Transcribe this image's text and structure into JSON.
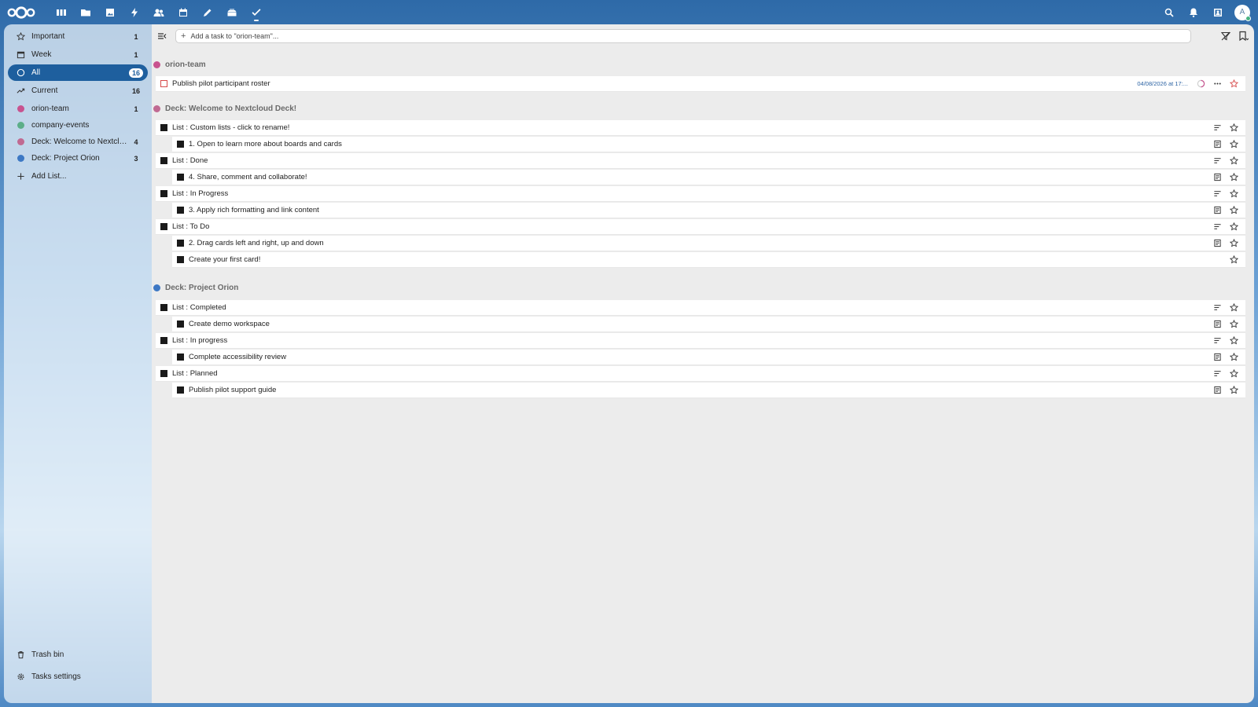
{
  "header": {
    "apps": [
      "dashboard",
      "files",
      "photos",
      "activity",
      "contacts",
      "calendar",
      "notes",
      "deck",
      "tasks"
    ],
    "right_icons": [
      "search",
      "notifications",
      "contacts-menu"
    ],
    "avatar_initial": "A"
  },
  "sidebar": {
    "items": [
      {
        "label": "Important",
        "count": "1",
        "icon": "star-icon"
      },
      {
        "label": "Week",
        "count": "1",
        "icon": "calendar-icon"
      },
      {
        "label": "All",
        "count": "16",
        "icon": "circle-icon"
      },
      {
        "label": "Current",
        "count": "16",
        "icon": "trend-icon"
      },
      {
        "label": "orion-team",
        "count": "1",
        "color": "#c8538f"
      },
      {
        "label": "company-events",
        "count": "",
        "color": "#5cae88"
      },
      {
        "label": "Deck: Welcome to Nextclou...",
        "count": "4",
        "color": "#c06a92"
      },
      {
        "label": "Deck: Project Orion",
        "count": "3",
        "color": "#3d78c4"
      }
    ],
    "add_list": "Add List...",
    "trash": "Trash bin",
    "settings": "Tasks settings"
  },
  "main": {
    "add_placeholder": "Add a task to \"orion-team\"...",
    "sections": [
      {
        "title": "orion-team",
        "color": "#c8538f",
        "tasks": [
          {
            "title": "Publish pilot participant roster",
            "due": "04/08/2026 at 17:..."
          }
        ]
      },
      {
        "title": "Deck: Welcome to Nextcloud Deck!",
        "color": "#c06a92",
        "tasks": [
          {
            "title": "List : Custom lists - click to rename!"
          },
          {
            "title": "1. Open to learn more about boards and cards"
          },
          {
            "title": "List : Done"
          },
          {
            "title": "4. Share, comment and collaborate!"
          },
          {
            "title": "List : In Progress"
          },
          {
            "title": "3. Apply rich formatting and link content"
          },
          {
            "title": "List : To Do"
          },
          {
            "title": "2. Drag cards left and right, up and down"
          },
          {
            "title": "Create your first card!"
          }
        ]
      },
      {
        "title": "Deck: Project Orion",
        "color": "#3d78c4",
        "tasks": [
          {
            "title": "List : Completed"
          },
          {
            "title": "Create demo workspace"
          },
          {
            "title": "List : In progress"
          },
          {
            "title": "Complete accessibility review"
          },
          {
            "title": "List : Planned"
          },
          {
            "title": "Publish pilot support guide"
          }
        ]
      }
    ]
  }
}
